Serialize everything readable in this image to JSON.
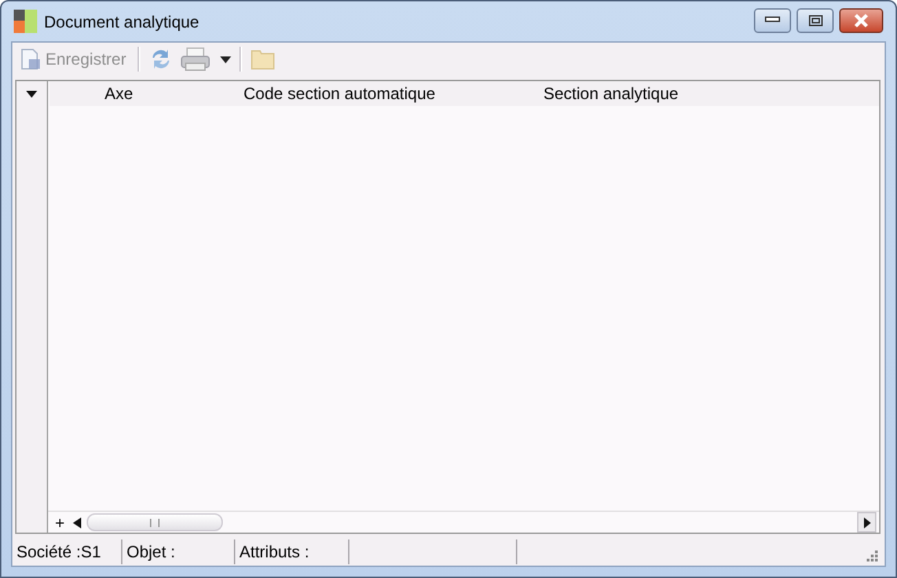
{
  "window": {
    "title": "Document analytique"
  },
  "toolbar": {
    "save": {
      "label": "Enregistrer",
      "disabled": true
    }
  },
  "grid": {
    "columns": [
      "Axe",
      "Code section automatique",
      "Section analytique"
    ],
    "add_glyph": "+"
  },
  "status_bar": {
    "panels": [
      "Société :S1",
      "Objet :",
      "Attributs :"
    ]
  }
}
